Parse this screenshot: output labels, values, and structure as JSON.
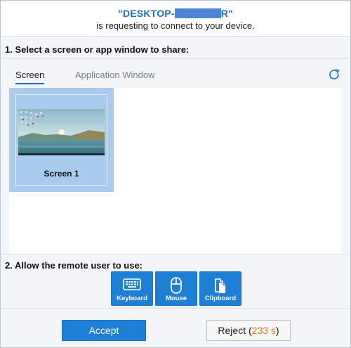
{
  "header": {
    "requester_prefix": "\"DESKTOP-",
    "requester_suffix": "R\"",
    "subtitle": "is requesting to connect to your device."
  },
  "section_share": {
    "title": "1. Select a screen or app window to share:"
  },
  "tabs": [
    {
      "label": "Screen",
      "active": true
    },
    {
      "label": "Application Window",
      "active": false
    }
  ],
  "icons": {
    "refresh": "refresh-icon",
    "keyboard": "keyboard-icon",
    "mouse": "mouse-icon",
    "clipboard": "clipboard-icon"
  },
  "screens": [
    {
      "label": "Screen 1",
      "selected": true
    }
  ],
  "section_permissions": {
    "title": "2. Allow the remote user to use:",
    "items": [
      {
        "label": "Keyboard"
      },
      {
        "label": "Mouse"
      },
      {
        "label": "Clipboard"
      }
    ]
  },
  "footer": {
    "accept_label": "Accept",
    "reject_label": "Reject",
    "countdown_open": "(",
    "countdown": "233 s",
    "countdown_close": ")"
  },
  "colors": {
    "accent": "#1e7fd6",
    "title_blue": "#1f6fc1",
    "countdown": "#e8761b",
    "selected_card": "#a9cbee"
  }
}
